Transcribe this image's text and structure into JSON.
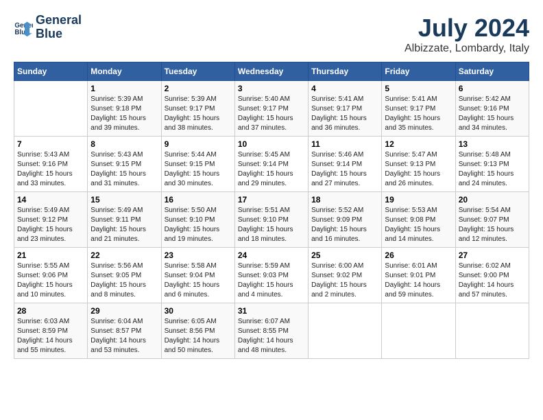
{
  "header": {
    "logo_line1": "General",
    "logo_line2": "Blue",
    "month": "July 2024",
    "location": "Albizzate, Lombardy, Italy"
  },
  "weekdays": [
    "Sunday",
    "Monday",
    "Tuesday",
    "Wednesday",
    "Thursday",
    "Friday",
    "Saturday"
  ],
  "weeks": [
    [
      {
        "day": "",
        "info": ""
      },
      {
        "day": "1",
        "info": "Sunrise: 5:39 AM\nSunset: 9:18 PM\nDaylight: 15 hours\nand 39 minutes."
      },
      {
        "day": "2",
        "info": "Sunrise: 5:39 AM\nSunset: 9:17 PM\nDaylight: 15 hours\nand 38 minutes."
      },
      {
        "day": "3",
        "info": "Sunrise: 5:40 AM\nSunset: 9:17 PM\nDaylight: 15 hours\nand 37 minutes."
      },
      {
        "day": "4",
        "info": "Sunrise: 5:41 AM\nSunset: 9:17 PM\nDaylight: 15 hours\nand 36 minutes."
      },
      {
        "day": "5",
        "info": "Sunrise: 5:41 AM\nSunset: 9:17 PM\nDaylight: 15 hours\nand 35 minutes."
      },
      {
        "day": "6",
        "info": "Sunrise: 5:42 AM\nSunset: 9:16 PM\nDaylight: 15 hours\nand 34 minutes."
      }
    ],
    [
      {
        "day": "7",
        "info": "Sunrise: 5:43 AM\nSunset: 9:16 PM\nDaylight: 15 hours\nand 33 minutes."
      },
      {
        "day": "8",
        "info": "Sunrise: 5:43 AM\nSunset: 9:15 PM\nDaylight: 15 hours\nand 31 minutes."
      },
      {
        "day": "9",
        "info": "Sunrise: 5:44 AM\nSunset: 9:15 PM\nDaylight: 15 hours\nand 30 minutes."
      },
      {
        "day": "10",
        "info": "Sunrise: 5:45 AM\nSunset: 9:14 PM\nDaylight: 15 hours\nand 29 minutes."
      },
      {
        "day": "11",
        "info": "Sunrise: 5:46 AM\nSunset: 9:14 PM\nDaylight: 15 hours\nand 27 minutes."
      },
      {
        "day": "12",
        "info": "Sunrise: 5:47 AM\nSunset: 9:13 PM\nDaylight: 15 hours\nand 26 minutes."
      },
      {
        "day": "13",
        "info": "Sunrise: 5:48 AM\nSunset: 9:13 PM\nDaylight: 15 hours\nand 24 minutes."
      }
    ],
    [
      {
        "day": "14",
        "info": "Sunrise: 5:49 AM\nSunset: 9:12 PM\nDaylight: 15 hours\nand 23 minutes."
      },
      {
        "day": "15",
        "info": "Sunrise: 5:49 AM\nSunset: 9:11 PM\nDaylight: 15 hours\nand 21 minutes."
      },
      {
        "day": "16",
        "info": "Sunrise: 5:50 AM\nSunset: 9:10 PM\nDaylight: 15 hours\nand 19 minutes."
      },
      {
        "day": "17",
        "info": "Sunrise: 5:51 AM\nSunset: 9:10 PM\nDaylight: 15 hours\nand 18 minutes."
      },
      {
        "day": "18",
        "info": "Sunrise: 5:52 AM\nSunset: 9:09 PM\nDaylight: 15 hours\nand 16 minutes."
      },
      {
        "day": "19",
        "info": "Sunrise: 5:53 AM\nSunset: 9:08 PM\nDaylight: 15 hours\nand 14 minutes."
      },
      {
        "day": "20",
        "info": "Sunrise: 5:54 AM\nSunset: 9:07 PM\nDaylight: 15 hours\nand 12 minutes."
      }
    ],
    [
      {
        "day": "21",
        "info": "Sunrise: 5:55 AM\nSunset: 9:06 PM\nDaylight: 15 hours\nand 10 minutes."
      },
      {
        "day": "22",
        "info": "Sunrise: 5:56 AM\nSunset: 9:05 PM\nDaylight: 15 hours\nand 8 minutes."
      },
      {
        "day": "23",
        "info": "Sunrise: 5:58 AM\nSunset: 9:04 PM\nDaylight: 15 hours\nand 6 minutes."
      },
      {
        "day": "24",
        "info": "Sunrise: 5:59 AM\nSunset: 9:03 PM\nDaylight: 15 hours\nand 4 minutes."
      },
      {
        "day": "25",
        "info": "Sunrise: 6:00 AM\nSunset: 9:02 PM\nDaylight: 15 hours\nand 2 minutes."
      },
      {
        "day": "26",
        "info": "Sunrise: 6:01 AM\nSunset: 9:01 PM\nDaylight: 14 hours\nand 59 minutes."
      },
      {
        "day": "27",
        "info": "Sunrise: 6:02 AM\nSunset: 9:00 PM\nDaylight: 14 hours\nand 57 minutes."
      }
    ],
    [
      {
        "day": "28",
        "info": "Sunrise: 6:03 AM\nSunset: 8:59 PM\nDaylight: 14 hours\nand 55 minutes."
      },
      {
        "day": "29",
        "info": "Sunrise: 6:04 AM\nSunset: 8:57 PM\nDaylight: 14 hours\nand 53 minutes."
      },
      {
        "day": "30",
        "info": "Sunrise: 6:05 AM\nSunset: 8:56 PM\nDaylight: 14 hours\nand 50 minutes."
      },
      {
        "day": "31",
        "info": "Sunrise: 6:07 AM\nSunset: 8:55 PM\nDaylight: 14 hours\nand 48 minutes."
      },
      {
        "day": "",
        "info": ""
      },
      {
        "day": "",
        "info": ""
      },
      {
        "day": "",
        "info": ""
      }
    ]
  ]
}
